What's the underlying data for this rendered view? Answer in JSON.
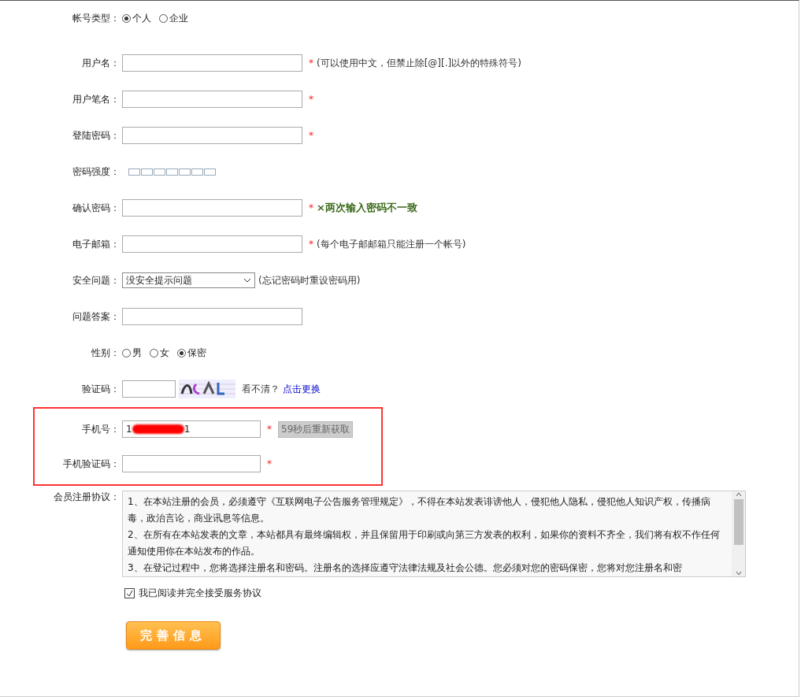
{
  "account_type": {
    "label": "帐号类型：",
    "options": [
      {
        "label": "个人",
        "selected": true
      },
      {
        "label": "企业",
        "selected": false
      }
    ]
  },
  "fields": [
    {
      "kind": "text",
      "label": "用户名：",
      "mark": "*",
      "hint": "(可以使用中文，但禁止除[@][.]以外的特殊符号)"
    },
    {
      "kind": "text",
      "label": "用户笔名：",
      "mark": "*"
    },
    {
      "kind": "text",
      "label": "登陆密码：",
      "mark": "*"
    },
    {
      "kind": "strength",
      "label": "密码强度："
    },
    {
      "kind": "text",
      "label": "确认密码：",
      "mark": "*",
      "error": "×两次输入密码不一致"
    },
    {
      "kind": "text",
      "label": "电子邮箱：",
      "mark": "*",
      "hint": "(每个电子邮邮箱只能注册一个帐号)"
    },
    {
      "kind": "select",
      "label": "安全问题：",
      "value": "没安全提示问题",
      "hint": "(忘记密码时重设密码用)"
    },
    {
      "kind": "text",
      "label": "问题答案："
    },
    {
      "kind": "radio",
      "label": "性别：",
      "options": [
        {
          "label": "男",
          "selected": false
        },
        {
          "label": "女",
          "selected": false
        },
        {
          "label": "保密",
          "selected": true
        }
      ]
    },
    {
      "kind": "captcha",
      "label": "验证码：",
      "prompt": "看不清？",
      "link": "点击更换"
    }
  ],
  "phone_section": {
    "fields": [
      {
        "kind": "phone",
        "label": "手机号：",
        "value_start": "1",
        "value_end": "1",
        "redacted": true,
        "mark": "*",
        "button": "59秒后重新获取"
      },
      {
        "kind": "text",
        "label": "手机验证码：",
        "mark": "*"
      }
    ]
  },
  "agreement": {
    "label": "会员注册协议：",
    "paragraphs": [
      "1、在本站注册的会员，必须遵守《互联网电子公告服务管理规定》，不得在本站发表诽谤他人，侵犯他人隐私，侵犯他人知识产权，传播病毒，政治言论，商业讯息等信息。",
      "2、在所有在本站发表的文章，本站都具有最终编辑权，并且保留用于印刷或向第三方发表的权利，如果你的资料不齐全，我们将有权不作任何通知使用你在本站发布的作品。",
      "3、在登记过程中，您将选择注册名和密码。注册名的选择应遵守法律法规及社会公德。您必须对您的密码保密，您将对您注册名和密"
    ],
    "accept": {
      "label": "我已阅读并完全接受服务协议",
      "checked": true
    }
  },
  "submit": "完善信息"
}
